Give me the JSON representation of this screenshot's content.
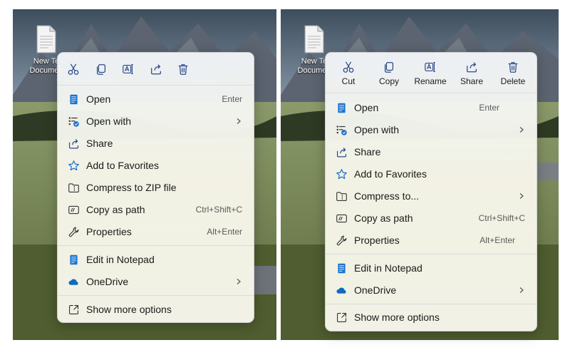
{
  "desktop_icon": {
    "label_line1": "New Te",
    "label_line2": "Documen"
  },
  "left_menu": {
    "toolbar": [
      "Cut",
      "Copy",
      "Rename",
      "Share",
      "Delete"
    ],
    "items": [
      {
        "label": "Open",
        "shortcut": "Enter",
        "icon": "notepad-icon"
      },
      {
        "label": "Open with",
        "shortcut": "",
        "submenu": true,
        "icon": "open-with-icon"
      },
      {
        "label": "Share",
        "shortcut": "",
        "icon": "share-icon"
      },
      {
        "label": "Add to Favorites",
        "shortcut": "",
        "icon": "star-icon"
      },
      {
        "label": "Compress to ZIP file",
        "shortcut": "",
        "icon": "zip-icon"
      },
      {
        "label": "Copy as path",
        "shortcut": "Ctrl+Shift+C",
        "icon": "path-icon"
      },
      {
        "label": "Properties",
        "shortcut": "Alt+Enter",
        "icon": "wrench-icon"
      },
      {
        "label": "Edit in Notepad",
        "shortcut": "",
        "icon": "notepad-icon"
      },
      {
        "label": "OneDrive",
        "shortcut": "",
        "submenu": true,
        "icon": "cloud-icon"
      },
      {
        "label": "Show more options",
        "shortcut": "",
        "icon": "more-options-icon"
      }
    ]
  },
  "right_menu": {
    "toolbar": [
      "Cut",
      "Copy",
      "Rename",
      "Share",
      "Delete"
    ],
    "items": [
      {
        "label": "Open",
        "shortcut": "Enter",
        "icon": "notepad-icon"
      },
      {
        "label": "Open with",
        "shortcut": "",
        "submenu": true,
        "icon": "open-with-icon"
      },
      {
        "label": "Share",
        "shortcut": "",
        "icon": "share-icon"
      },
      {
        "label": "Add to Favorites",
        "shortcut": "",
        "icon": "star-icon"
      },
      {
        "label": "Compress to...",
        "shortcut": "",
        "submenu": true,
        "icon": "zip-icon"
      },
      {
        "label": "Copy as path",
        "shortcut": "Ctrl+Shift+C",
        "icon": "path-icon"
      },
      {
        "label": "Properties",
        "shortcut": "Alt+Enter",
        "icon": "wrench-icon"
      },
      {
        "label": "Edit in Notepad",
        "shortcut": "",
        "icon": "notepad-icon"
      },
      {
        "label": "OneDrive",
        "shortcut": "",
        "submenu": true,
        "icon": "cloud-icon"
      },
      {
        "label": "Show more options",
        "shortcut": "",
        "icon": "more-options-icon"
      }
    ]
  },
  "colors": {
    "accent": "#1a6fc9",
    "menu_text": "#1a1a1a",
    "shortcut_text": "#5a5a5a"
  }
}
